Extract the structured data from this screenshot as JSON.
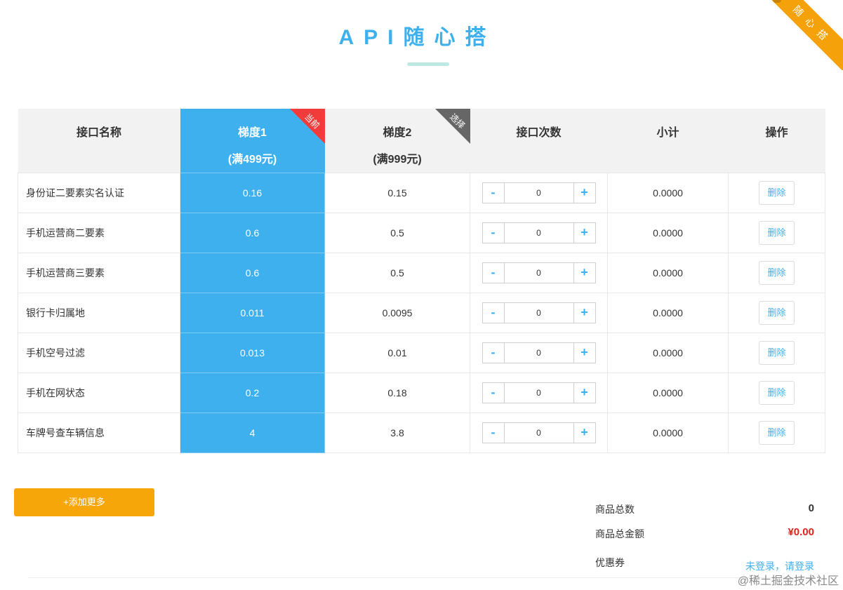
{
  "ribbon": {
    "text": "随心搭"
  },
  "title": "API随心搭",
  "table": {
    "headers": {
      "name": "接口名称",
      "tier1": "梯度1",
      "tier1_sub": "(满499元)",
      "tier1_badge": "当前",
      "tier2": "梯度2",
      "tier2_sub": "(满999元)",
      "tier2_badge": "选择",
      "count": "接口次数",
      "subtotal": "小计",
      "action": "操作"
    },
    "rows": [
      {
        "name": "身份证二要素实名认证",
        "tier1": "0.16",
        "tier2": "0.15",
        "count": "0",
        "subtotal": "0.0000",
        "action": "删除"
      },
      {
        "name": "手机运营商二要素",
        "tier1": "0.6",
        "tier2": "0.5",
        "count": "0",
        "subtotal": "0.0000",
        "action": "删除"
      },
      {
        "name": "手机运营商三要素",
        "tier1": "0.6",
        "tier2": "0.5",
        "count": "0",
        "subtotal": "0.0000",
        "action": "删除"
      },
      {
        "name": "银行卡归属地",
        "tier1": "0.011",
        "tier2": "0.0095",
        "count": "0",
        "subtotal": "0.0000",
        "action": "删除"
      },
      {
        "name": "手机空号过滤",
        "tier1": "0.013",
        "tier2": "0.01",
        "count": "0",
        "subtotal": "0.0000",
        "action": "删除"
      },
      {
        "name": "手机在网状态",
        "tier1": "0.2",
        "tier2": "0.18",
        "count": "0",
        "subtotal": "0.0000",
        "action": "删除"
      },
      {
        "name": "车牌号查车辆信息",
        "tier1": "4",
        "tier2": "3.8",
        "count": "0",
        "subtotal": "0.0000",
        "action": "删除"
      }
    ],
    "stepper": {
      "minus": "-",
      "plus": "+"
    }
  },
  "add_more": "+添加更多",
  "summary": {
    "count_label": "商品总数",
    "count_value": "0",
    "amount_label": "商品总金额",
    "amount_value": "¥0.00",
    "coupon_label": "优惠券",
    "login_link": "未登录，请登录"
  },
  "watermark": "@稀土掘金技术社区",
  "colors": {
    "accent": "#3fb0ee",
    "orange": "#f7a60a",
    "price_red": "#e0211f",
    "badge_red": "#f23c3c",
    "badge_grey": "#666666"
  }
}
